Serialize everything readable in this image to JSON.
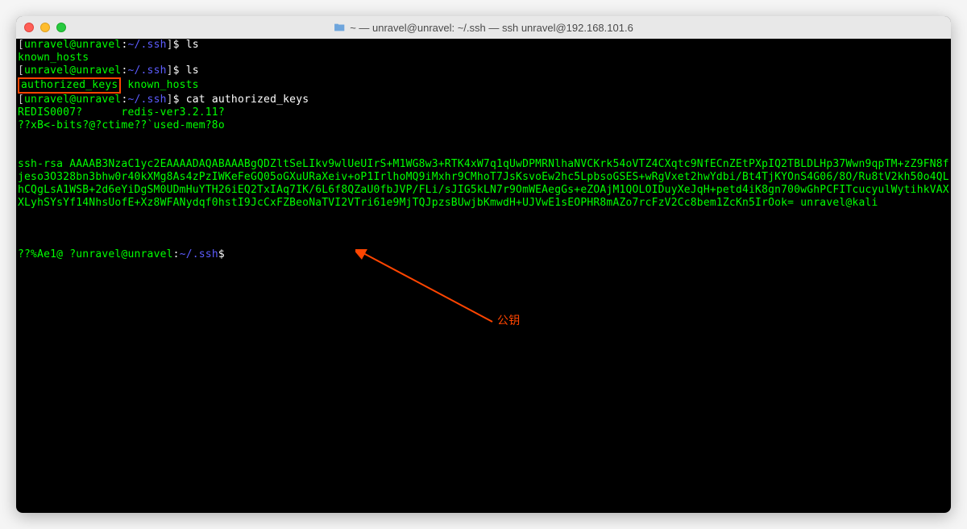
{
  "window": {
    "title": "~ — unravel@unravel: ~/.ssh — ssh unravel@192.168.101.6"
  },
  "terminal": {
    "prompt1": {
      "open_bracket": "[",
      "userhost": "unravel@unravel",
      "colon": ":",
      "path": "~/.ssh",
      "close_bracket": "]",
      "dollar": "$",
      "cmd": "ls"
    },
    "output1": "known_hosts",
    "prompt2": {
      "cmd": "ls"
    },
    "output2": {
      "highlighted": "authorized_keys",
      "rest": "known_hosts"
    },
    "prompt3": {
      "cmd": "cat authorized_keys"
    },
    "cat_output": {
      "line1": "REDIS0007?      redis-ver3.2.11?",
      "line2": "??xB<-bits?@?ctime??`used-mem?8o",
      "ssh_key": "ssh-rsa AAAAB3NzaC1yc2EAAAADAQABAAABgQDZltSeLIkv9wlUeUIrS+M1WG8w3+RTK4xW7q1qUwDPMRNlhaNVCKrk54oVTZ4CXqtc9NfECnZEtPXpIQ2TBLDLHp37Wwn9qpTM+zZ9FN8fjeso3O328bn3bhw0r40kXMg8As4zPzIWKeFeGQ05oGXuURaXeiv+oP1IrlhoMQ9iMxhr9CMhoT7JsKsvoEw2hc5LpbsoGSES+wRgVxet2hwYdbi/Bt4TjKYOnS4G06/8O/Ru8tV2kh50o4QLhCQgLsA1WSB+2d6eYiDgSM0UDmHuYTH26iEQ2TxIAq7IK/6L6f8QZaU0fbJVP/FLi/sJIG5kLN7r9OmWEAegGs+eZOAjM1QOLOIDuyXeJqH+petd4iK8gn700wGhPCFITcucyulWytihkVAXXLyhSYsYf14NhsUofE+Xz8WFANydqf0hstI9JcCxFZBeoNaTVI2VTri61e9MjTQJpzsBUwjbKmwdH+UJVwE1sEOPHR8mAZo7rcFzV2Cc8bem1ZcKn5IrOok= unravel@kali"
    },
    "prompt_final": {
      "prefix": "??%Ae1@ ?",
      "userhost": "unravel@unravel",
      "colon": ":",
      "path": "~/.ssh",
      "dollar": "$"
    }
  },
  "annotation": {
    "label": "公钥"
  }
}
